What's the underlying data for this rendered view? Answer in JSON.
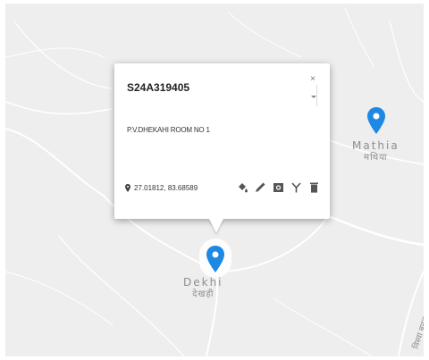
{
  "map": {
    "background_color": "#eeeeee",
    "road_color": "#ffffff",
    "marker_color": "#1e88e5",
    "places": [
      {
        "name": "Mathia",
        "native": "मथिया"
      },
      {
        "name": "Dekhi",
        "native": "देखही"
      }
    ],
    "road_label": "विस्वा बनकट मार्ग"
  },
  "popup": {
    "title": "S24A319405",
    "address": "P.V.DHEKAHI ROOM NO 1",
    "coordinates": "27.01812, 83.68589",
    "close_glyph": "×",
    "icons": {
      "location": "map-pin-icon",
      "actions": [
        "paint-bucket-icon",
        "pencil-icon",
        "camera-icon",
        "antenna-icon",
        "trash-icon"
      ]
    }
  }
}
